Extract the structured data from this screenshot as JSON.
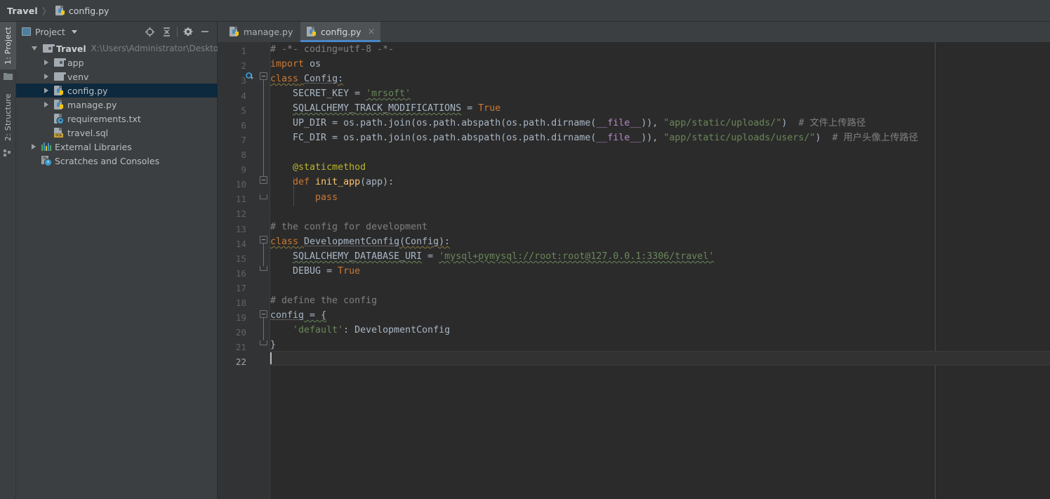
{
  "breadcrumb": {
    "root": "Travel",
    "separator": "〉",
    "file": "config.py"
  },
  "tool_strip": {
    "project_label": "1: Project",
    "structure_label": "2: Structure"
  },
  "project_panel": {
    "title": "Project",
    "toolbar_icons": [
      "locate-icon",
      "collapse-all-icon",
      "settings-gear-icon",
      "hide-icon"
    ],
    "tree": [
      {
        "label": "Travel",
        "path": "X:\\Users\\Administrator\\Desktop\\py",
        "icon": "folder-module-icon",
        "twisty": "open",
        "indent": 0,
        "bold": true,
        "selected": false
      },
      {
        "label": "app",
        "path": "",
        "icon": "folder-source-icon",
        "twisty": "closed",
        "indent": 1,
        "bold": false,
        "selected": false
      },
      {
        "label": "venv",
        "path": "",
        "icon": "folder-icon",
        "twisty": "closed",
        "indent": 1,
        "bold": false,
        "selected": false
      },
      {
        "label": "config.py",
        "path": "",
        "icon": "python-file-icon",
        "twisty": "closed",
        "indent": 1,
        "bold": false,
        "selected": true
      },
      {
        "label": "manage.py",
        "path": "",
        "icon": "python-file-icon",
        "twisty": "closed",
        "indent": 1,
        "bold": false,
        "selected": false
      },
      {
        "label": "requirements.txt",
        "path": "",
        "icon": "text-config-file-icon",
        "twisty": "none",
        "indent": 1,
        "bold": false,
        "selected": false
      },
      {
        "label": "travel.sql",
        "path": "",
        "icon": "sql-file-icon",
        "twisty": "none",
        "indent": 1,
        "bold": false,
        "selected": false
      },
      {
        "label": "External Libraries",
        "path": "",
        "icon": "libraries-icon",
        "twisty": "closed",
        "indent": 0,
        "bold": false,
        "selected": false
      },
      {
        "label": "Scratches and Consoles",
        "path": "",
        "icon": "scratches-icon",
        "twisty": "none",
        "indent": 0,
        "bold": false,
        "selected": false
      }
    ]
  },
  "editor": {
    "tabs": [
      {
        "label": "manage.py",
        "icon": "python-file-icon",
        "active": false,
        "close_glyph": "×"
      },
      {
        "label": "config.py",
        "icon": "python-file-icon",
        "active": true,
        "close_glyph": "×"
      }
    ],
    "active_tab": "config.py",
    "caret_line": 22,
    "line_numbers": [
      1,
      2,
      3,
      4,
      5,
      6,
      7,
      8,
      9,
      10,
      11,
      12,
      13,
      14,
      15,
      16,
      17,
      18,
      19,
      20,
      21,
      22
    ],
    "code_lines": [
      {
        "n": 1,
        "text": "# -*- coding=utf-8 -*-"
      },
      {
        "n": 2,
        "text": "import os"
      },
      {
        "n": 3,
        "text": "class Config:"
      },
      {
        "n": 4,
        "text": "    SECRET_KEY = 'mrsoft'"
      },
      {
        "n": 5,
        "text": "    SQLALCHEMY_TRACK_MODIFICATIONS = True"
      },
      {
        "n": 6,
        "text": "    UP_DIR = os.path.join(os.path.abspath(os.path.dirname(__file__)), \"app/static/uploads/\")  # 文件上传路径"
      },
      {
        "n": 7,
        "text": "    FC_DIR = os.path.join(os.path.abspath(os.path.dirname(__file__)), \"app/static/uploads/users/\")  # 用户头像上传路径"
      },
      {
        "n": 8,
        "text": ""
      },
      {
        "n": 9,
        "text": "    @staticmethod"
      },
      {
        "n": 10,
        "text": "    def init_app(app):"
      },
      {
        "n": 11,
        "text": "        pass"
      },
      {
        "n": 12,
        "text": ""
      },
      {
        "n": 13,
        "text": "# the config for development"
      },
      {
        "n": 14,
        "text": "class DevelopmentConfig(Config):"
      },
      {
        "n": 15,
        "text": "    SQLALCHEMY_DATABASE_URI = 'mysql+pymysql://root:root@127.0.0.1:3306/travel'"
      },
      {
        "n": 16,
        "text": "    DEBUG = True"
      },
      {
        "n": 17,
        "text": ""
      },
      {
        "n": 18,
        "text": "# define the config"
      },
      {
        "n": 19,
        "text": "config = {"
      },
      {
        "n": 20,
        "text": "    'default': DevelopmentConfig"
      },
      {
        "n": 21,
        "text": "}"
      },
      {
        "n": 22,
        "text": ""
      }
    ],
    "tokens": {
      "l1_comment": "# -*- coding=utf-8 -*-",
      "l2_kw": "import",
      "l2_mod": "os",
      "l3_kw": "class",
      "l3_name": "Config",
      "l3_colon": ":",
      "l4_name": "SECRET_KEY",
      "l4_eq": " = ",
      "l4_str": "'mrsoft'",
      "l5_name": "SQLALCHEMY_TRACK_MODIFICATIONS",
      "l5_eq": " = ",
      "l5_const": "True",
      "l6_name": "UP_DIR",
      "l6_mid": " = os.path.join(os.path.abspath(os.path.dirname(",
      "l6_dunder": "__file__",
      "l6_close": ")), ",
      "l6_str": "\"app/static/uploads/\"",
      "l6_paren": ")",
      "l6_comment": "# 文件上传路径",
      "l7_name": "FC_DIR",
      "l7_mid": " = os.path.join(os.path.abspath(os.path.dirname(",
      "l7_dunder": "__file__",
      "l7_close": ")), ",
      "l7_str": "\"app/static/uploads/users/\"",
      "l7_paren": ")",
      "l7_comment": "# 用户头像上传路径",
      "l9_decorator": "@staticmethod",
      "l10_kw": "def",
      "l10_fn": "init_app",
      "l10_sig": "(app):",
      "l11_kw": "pass",
      "l13_comment": "# the config for development",
      "l14_kw": "class",
      "l14_name": "DevelopmentConfig",
      "l14_base": "(Config):",
      "l15_name": "SQLALCHEMY_DATABASE_URI",
      "l15_eq": " = ",
      "l15_str": "'mysql+pymysql://root:root@127.0.0.1:3306/travel'",
      "l16_name": "DEBUG",
      "l16_eq": " = ",
      "l16_const": "True",
      "l18_comment": "# define the config",
      "l19_name": "config",
      "l19_eq": " = {",
      "l20_key": "'default'",
      "l20_colon": ": ",
      "l20_val": "DevelopmentConfig",
      "l21_brace": "}"
    }
  },
  "colors": {
    "panel_bg": "#3c3f41",
    "editor_bg": "#2b2b2b",
    "gutter_bg": "#313335",
    "selection_bg": "#0d293e",
    "tab_active_bg": "#4e5254",
    "tab_underline": "#4a88c7",
    "keyword": "#cc7832",
    "string": "#6a8759",
    "comment": "#808080",
    "decorator": "#bbb529",
    "function": "#ffc66d",
    "dunder": "#b389c5",
    "text": "#a9b7c6",
    "line_number": "#606366"
  }
}
